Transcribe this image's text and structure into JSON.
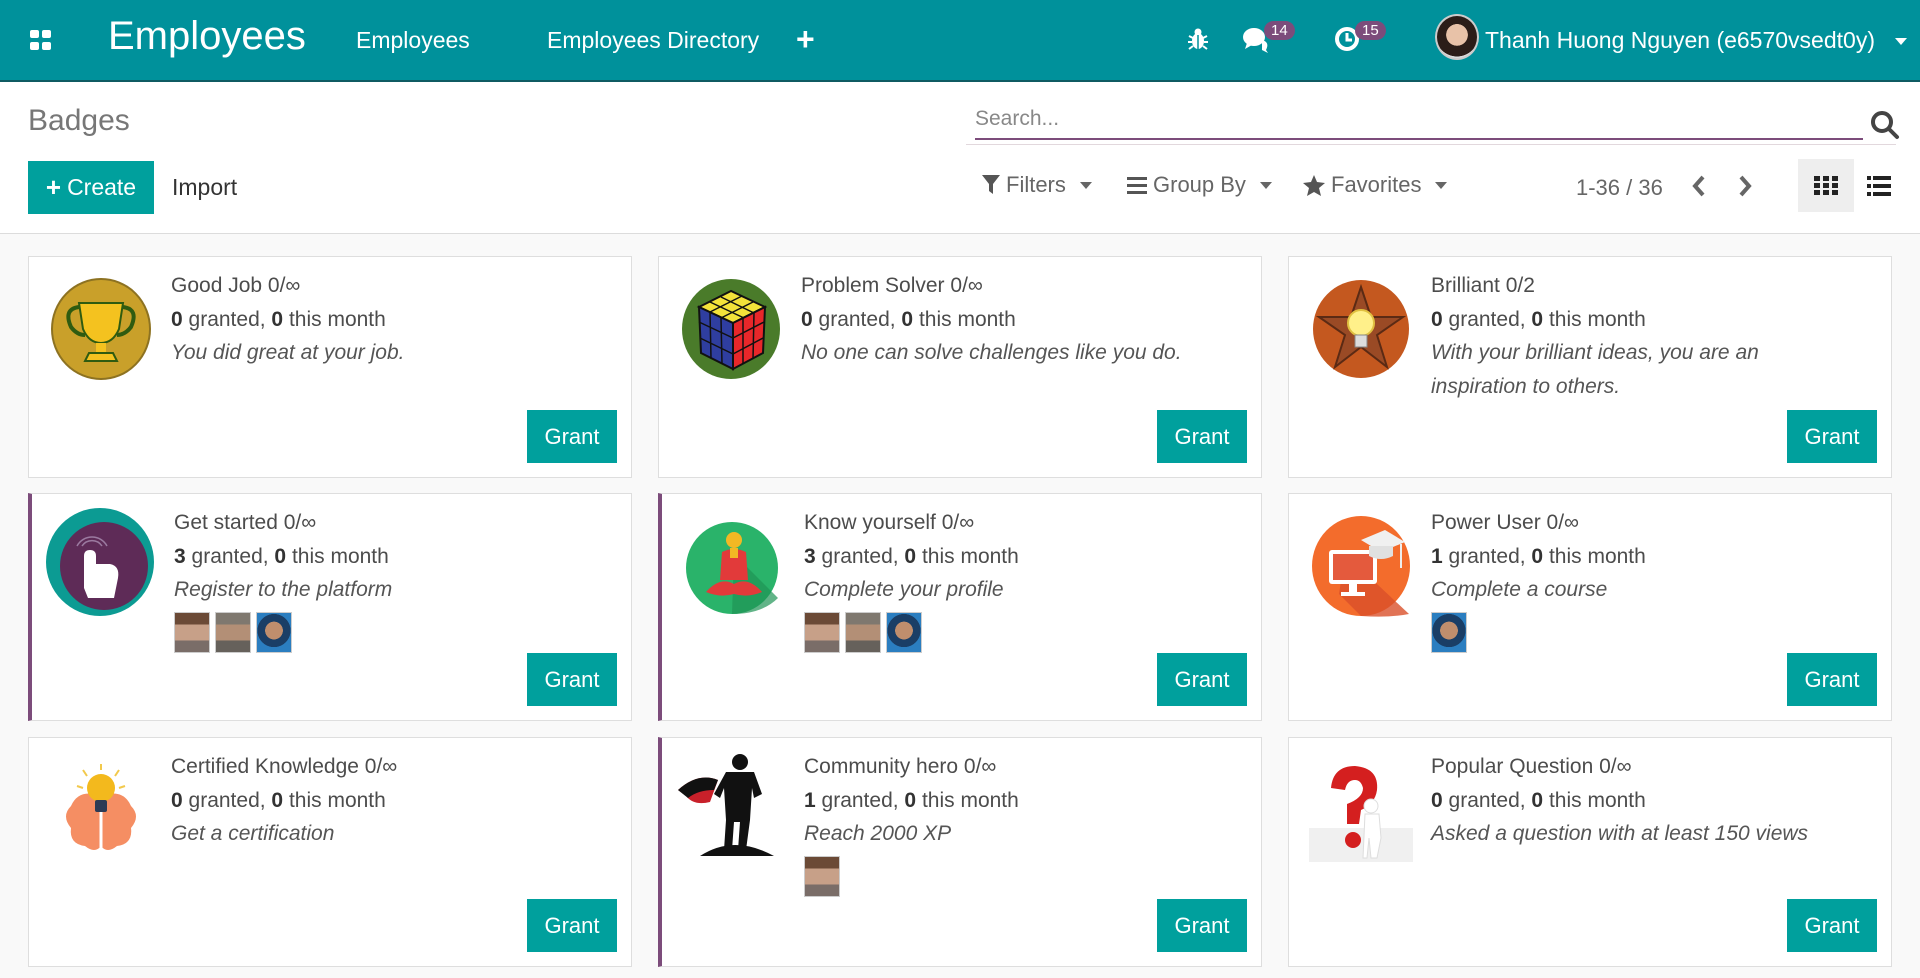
{
  "navbar": {
    "app_title": "Employees",
    "menu": [
      "Employees",
      "Employees Directory"
    ],
    "messages_count": "14",
    "activities_count": "15",
    "user_name": "Thanh Huong Nguyen (e6570vsedt0y)"
  },
  "control_panel": {
    "title": "Badges",
    "create_label": "Create",
    "import_label": "Import",
    "search_placeholder": "Search...",
    "filters_label": "Filters",
    "groupby_label": "Group By",
    "favorites_label": "Favorites",
    "pager": "1-36 / 36"
  },
  "colors": {
    "navbar": "#00919b",
    "primary_button": "#00a09d",
    "accent": "#7c4c7b"
  },
  "grant_label": "Grant",
  "badges": [
    {
      "name": "Good Job 0/∞",
      "granted": "0",
      "this_month": "0",
      "description": "You did great at your job.",
      "owners": [],
      "icon": "trophy-icon",
      "highlight": false
    },
    {
      "name": "Problem Solver 0/∞",
      "granted": "0",
      "this_month": "0",
      "description": "No one can solve challenges like you do.",
      "owners": [],
      "icon": "rubiks-cube-icon",
      "highlight": false
    },
    {
      "name": "Brilliant 0/2",
      "granted": "0",
      "this_month": "0",
      "description": "With your brilliant ideas, you are an inspiration to others.",
      "owners": [],
      "icon": "lightbulb-star-icon",
      "highlight": false
    },
    {
      "name": "Get started 0/∞",
      "granted": "3",
      "this_month": "0",
      "description": "Register to the platform",
      "owners": [
        "o1",
        "o2",
        "o3"
      ],
      "icon": "touch-hand-icon",
      "highlight": true
    },
    {
      "name": "Know yourself 0/∞",
      "granted": "3",
      "this_month": "0",
      "description": "Complete your profile",
      "owners": [
        "o1",
        "o2",
        "o3"
      ],
      "icon": "meditation-icon",
      "highlight": true
    },
    {
      "name": "Power User 0/∞",
      "granted": "1",
      "this_month": "0",
      "description": "Complete a course",
      "owners": [
        "o3"
      ],
      "icon": "graduation-monitor-icon",
      "highlight": false
    },
    {
      "name": "Certified Knowledge 0/∞",
      "granted": "0",
      "this_month": "0",
      "description": "Get a certification",
      "owners": [],
      "icon": "brain-lightbulb-icon",
      "highlight": false
    },
    {
      "name": "Community hero 0/∞",
      "granted": "1",
      "this_month": "0",
      "description": "Reach 2000 XP",
      "owners": [
        "o1"
      ],
      "icon": "superhero-icon",
      "highlight": true
    },
    {
      "name": "Popular Question 0/∞",
      "granted": "0",
      "this_month": "0",
      "description": "Asked a question with at least 150 views",
      "owners": [],
      "icon": "question-mark-icon",
      "highlight": false
    }
  ]
}
